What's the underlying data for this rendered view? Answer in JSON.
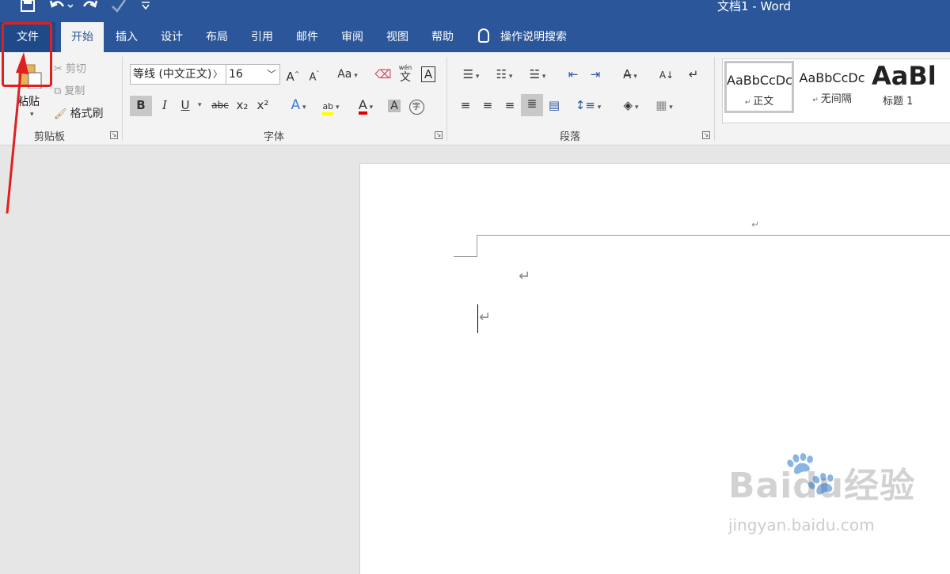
{
  "titlebar": {
    "doc_title": "文档1  -  Word",
    "icons": [
      "save-icon",
      "undo-icon",
      "redo-icon",
      "touch-mode-icon",
      "customize-icon"
    ]
  },
  "tabs": [
    {
      "label": "文件",
      "id": "file"
    },
    {
      "label": "开始",
      "id": "home",
      "active": true
    },
    {
      "label": "插入",
      "id": "insert"
    },
    {
      "label": "设计",
      "id": "design"
    },
    {
      "label": "布局",
      "id": "layout"
    },
    {
      "label": "引用",
      "id": "references"
    },
    {
      "label": "邮件",
      "id": "mailings"
    },
    {
      "label": "审阅",
      "id": "review"
    },
    {
      "label": "视图",
      "id": "view"
    },
    {
      "label": "帮助",
      "id": "help"
    }
  ],
  "tell_me": "操作说明搜索",
  "clipboard": {
    "paste_label": "粘贴",
    "cut_label": "剪切",
    "copy_label": "复制",
    "format_painter_label": "格式刷",
    "group_label": "剪贴板"
  },
  "font": {
    "font_name": "等线 (中文正文)",
    "font_size": "16",
    "group_label": "字体",
    "phonetic_top": "wén",
    "phonetic_char": "文",
    "border_char": "A",
    "enclose_char": "字",
    "case_label": "Aa",
    "grow_label": "A",
    "shrink_label": "A",
    "bold": "B",
    "italic": "I",
    "underline": "U",
    "strike": "abc",
    "subscript": "x₂",
    "superscript": "x²",
    "highlight_color": "#ffff00",
    "font_color": "#e00000"
  },
  "paragraph": {
    "group_label": "段落"
  },
  "styles": [
    {
      "sample": "AaBbCcDc",
      "name": "正文",
      "selected": true
    },
    {
      "sample": "AaBbCcDc",
      "name": "无间隔"
    },
    {
      "sample": "AaBl",
      "name": "标题 1"
    }
  ],
  "watermark": {
    "brand": "Baidu经验",
    "url": "jingyan.baidu.com"
  },
  "colors": {
    "accent": "#2b579a",
    "annotation": "#e02020"
  }
}
